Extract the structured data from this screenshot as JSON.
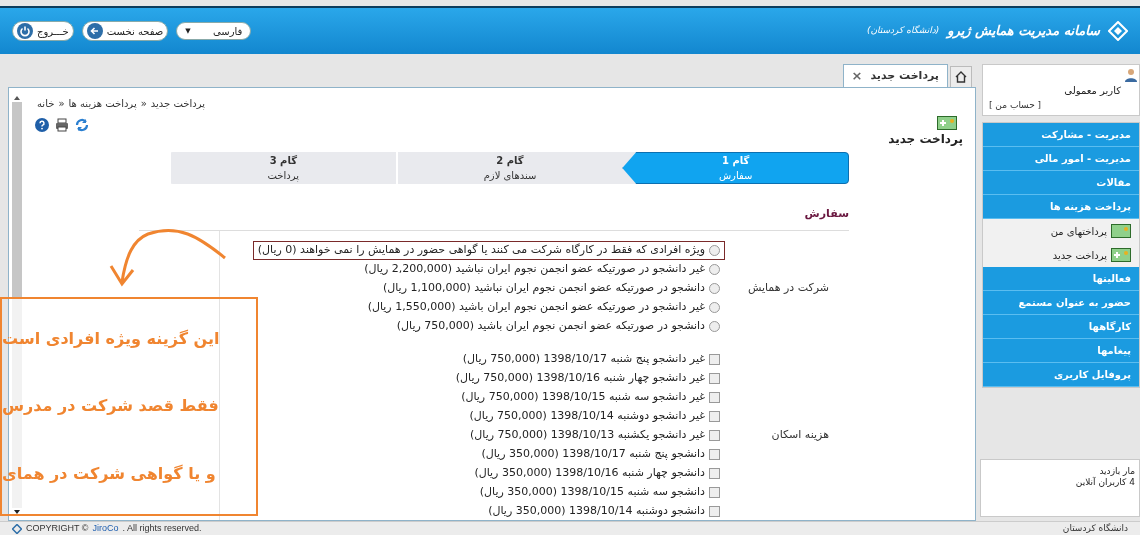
{
  "header": {
    "title": "سامانه مدیریت همایش ژیرو",
    "subtitle": "(دانشگاه کردستان)",
    "language": {
      "value": "فارسی",
      "caret": "▼"
    },
    "buttons": [
      {
        "label": "صفحه نخست",
        "kind": "home"
      },
      {
        "label": "خـــروج",
        "kind": "exit"
      }
    ]
  },
  "sidebar": {
    "user": "کاربر معمولی",
    "account_link": "[ حساب من ]",
    "items": [
      {
        "label": "مدیریت - مشارکت",
        "kind": "section"
      },
      {
        "label": "مدیریت - امور مالی",
        "kind": "section"
      },
      {
        "label": "مقالات",
        "kind": "section"
      },
      {
        "label": "پرداخت هزینه ها",
        "kind": "section"
      },
      {
        "label": "پرداختهای من",
        "kind": "sub"
      },
      {
        "label": "پرداخت جدید",
        "kind": "sub"
      },
      {
        "label": "فعالیتها",
        "kind": "section"
      },
      {
        "label": "حضور به عنوان مستمع",
        "kind": "section"
      },
      {
        "label": "کارگاهها",
        "kind": "section"
      },
      {
        "label": "پیغامها",
        "kind": "section"
      },
      {
        "label": "پروفایل کاربری",
        "kind": "section"
      }
    ],
    "stats": [
      "مار بازدید",
      "4 کاربران آنلاین"
    ]
  },
  "tabs": [
    {
      "kind": "home",
      "selected": false
    },
    {
      "label": "پرداخت جدید",
      "kind": "page",
      "selected": true,
      "close": "×"
    }
  ],
  "breadcrumb": {
    "items": [
      "پرداخت جدید",
      "پرداخت هزینه ها",
      "خانه"
    ],
    "separator": "«"
  },
  "page_title": "پرداخت جدید",
  "steps": [
    {
      "title": "گام 1",
      "subtitle": "سفارش",
      "selected": true
    },
    {
      "title": "گام 2",
      "subtitle": "سندهای لازم",
      "selected": false
    },
    {
      "title": "گام 3",
      "subtitle": "پرداخت",
      "selected": false
    }
  ],
  "section_title": "سفارش",
  "groups": [
    {
      "label": "شرکت در همایش",
      "kind": "radio",
      "options": [
        {
          "label": "ویژه افرادی که فقط در کارگاه شرکت می کنند یا گواهی حضور در همایش را نمی خواهند (0 ریال)",
          "selected": false,
          "highlighted": true
        },
        {
          "label": "غیر دانشجو در صورتیکه عضو انجمن نجوم ایران نباشید (2,200,000 ریال)",
          "selected": false,
          "highlighted": false
        },
        {
          "label": "دانشجو در صورتیکه عضو انجمن نجوم ایران نباشید (1,100,000 ریال)",
          "selected": false,
          "highlighted": false
        },
        {
          "label": "غیر دانشجو در صورتیکه عضو انجمن نجوم ایران باشید (1,550,000 ریال)",
          "selected": false,
          "highlighted": false
        },
        {
          "label": "دانشجو در صورتیکه عضو انجمن نجوم ایران باشید (750,000 ریال)",
          "selected": false,
          "highlighted": false
        }
      ]
    },
    {
      "label": "هزینه اسکان",
      "kind": "checkbox",
      "options": [
        {
          "label": "غیر دانشجو پنج شنبه 1398/10/17 (750,000 ریال)",
          "checked": false
        },
        {
          "label": "غیر دانشجو چهار شنبه 1398/10/16 (750,000 ریال)",
          "checked": false
        },
        {
          "label": "غیر دانشجو سه شنبه 1398/10/15 (750,000 ریال)",
          "checked": false
        },
        {
          "label": "غیر دانشجو دوشنبه 1398/10/14 (750,000 ریال)",
          "checked": false
        },
        {
          "label": "غیر دانشجو یکشنبه 1398/10/13 (750,000 ریال)",
          "checked": false
        },
        {
          "label": "دانشجو پنج شنبه 1398/10/17 (350,000 ریال)",
          "checked": false
        },
        {
          "label": "دانشجو چهار شنبه 1398/10/16 (350,000 ریال)",
          "checked": false
        },
        {
          "label": "دانشجو سه شنبه 1398/10/15 (350,000 ریال)",
          "checked": false
        },
        {
          "label": "دانشجو دوشنبه 1398/10/14 (350,000 ریال)",
          "checked": false
        }
      ]
    }
  ],
  "annotation": {
    "lines": [
      "این گزینه ویژه افرادی است",
      "فقط قصد شرکت در مدرس",
      "و یا گواهی شرکت در همای"
    ]
  },
  "footer": {
    "copyright": "COPYRIGHT ©",
    "link": "JiroCo",
    "rest": ". All rights reserved.",
    "right": "دانشگاه کردستان"
  }
}
